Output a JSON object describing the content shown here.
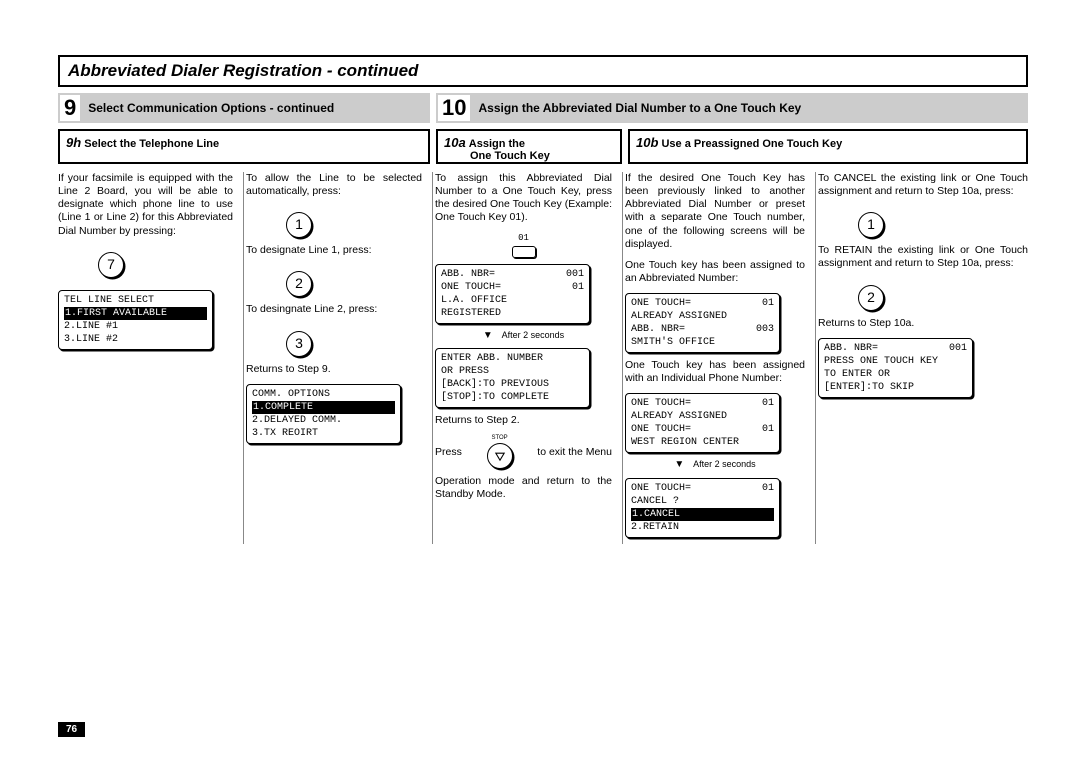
{
  "title": "Abbreviated Dialer Registration - continued",
  "page_number": "76",
  "step9": {
    "num": "9",
    "title": "Select Communication Options - continued"
  },
  "step10": {
    "num": "10",
    "title": "Assign the Abbreviated Dial Number to a One Touch Key"
  },
  "sub9h": {
    "lbl": "9h",
    "txt": "Select the Telephone Line"
  },
  "sub10a": {
    "lbl": "10a",
    "txt_l1": "Assign the",
    "txt_l2": "One Touch Key"
  },
  "sub10b": {
    "lbl": "10b",
    "txt": "Use a Preassigned One Touch Key"
  },
  "col1": {
    "p1": "If your facsimile is equipped with the Line 2 Board, you will be able to designate which phone line to use (Line 1 or Line 2) for this Abbreviated Dial Number by pressing:",
    "key": "7",
    "lcd1": {
      "l1": "TEL LINE SELECT",
      "l2_sel": "1.FIRST AVAILABLE",
      "l3": "2.LINE #1",
      "l4": "3.LINE #2"
    }
  },
  "col2": {
    "p1": "To allow the Line to be selected automatically, press:",
    "key1": "1",
    "p2": "To designate Line 1, press:",
    "key2": "2",
    "p3": "To desingnate Line 2, press:",
    "key3": "3",
    "p4": "Returns to Step 9.",
    "lcd": {
      "l1": "COMM. OPTIONS",
      "l2_sel": "1.COMPLETE",
      "l3": "2.DELAYED COMM.",
      "l4": "3.TX REOIRT"
    }
  },
  "col3": {
    "p1": "To assign this Abbreviated Dial Number to a One Touch Key, press the desired One Touch Key (Example: One Touch Key 01).",
    "ot_label": "01",
    "lcd1": {
      "l1a": "ABB. NBR=",
      "l1b": "001",
      "l2a": "ONE TOUCH=",
      "l2b": "01",
      "l3": "L.A. OFFICE",
      "l4": "REGISTERED"
    },
    "arrow1": {
      "sym": "▼",
      "lbl": "After 2 seconds"
    },
    "lcd2": {
      "l1": "ENTER ABB. NUMBER",
      "l2": "OR PRESS",
      "l3": "[BACK]:TO PREVIOUS",
      "l4": "[STOP]:TO COMPLETE"
    },
    "p2": "Returns  to Step 2.",
    "stop_lbl": "STOP",
    "press": "Press",
    "exit": "to exit the Menu",
    "p3": "Operation mode and return to the Standby Mode."
  },
  "col4": {
    "p1": "If the desired One Touch Key has been previously linked to another Abbreviated Dial Number or preset with a separate One Touch number, one of the following screens will be displayed.",
    "p2": "One Touch key has been assigned to an Abbreviated Number:",
    "lcd1": {
      "l1a": "ONE TOUCH=",
      "l1b": "01",
      "l2": "ALREADY ASSIGNED",
      "l3a": "ABB. NBR=",
      "l3b": "003",
      "l4": "SMITH'S OFFICE"
    },
    "p3": "One Touch key has been assigned with an Individual Phone Number:",
    "lcd2": {
      "l1a": "ONE TOUCH=",
      "l1b": "01",
      "l2": "ALREADY ASSIGNED",
      "l3a": "ONE TOUCH=",
      "l3b": "01",
      "l4": "WEST REGION CENTER"
    },
    "arrow": {
      "sym": "▼",
      "lbl": "After 2 seconds"
    },
    "lcd3": {
      "l1a": "ONE TOUCH=",
      "l1b": "01",
      "l2": "CANCEL ?",
      "l3_sel": "1.CANCEL",
      "l4": "2.RETAIN"
    }
  },
  "col5": {
    "p1": "To CANCEL the existing link or One Touch assignment and return to Step 10a, press:",
    "key1": "1",
    "p2": "To RETAIN the existing link or One Touch assignment and return to Step 10a, press:",
    "key2": "2",
    "p3": "Returns to Step 10a.",
    "lcd": {
      "l1a": "ABB. NBR=",
      "l1b": "001",
      "l2": "PRESS ONE TOUCH KEY",
      "l3": "TO ENTER OR",
      "l4": "[ENTER]:TO SKIP"
    }
  }
}
